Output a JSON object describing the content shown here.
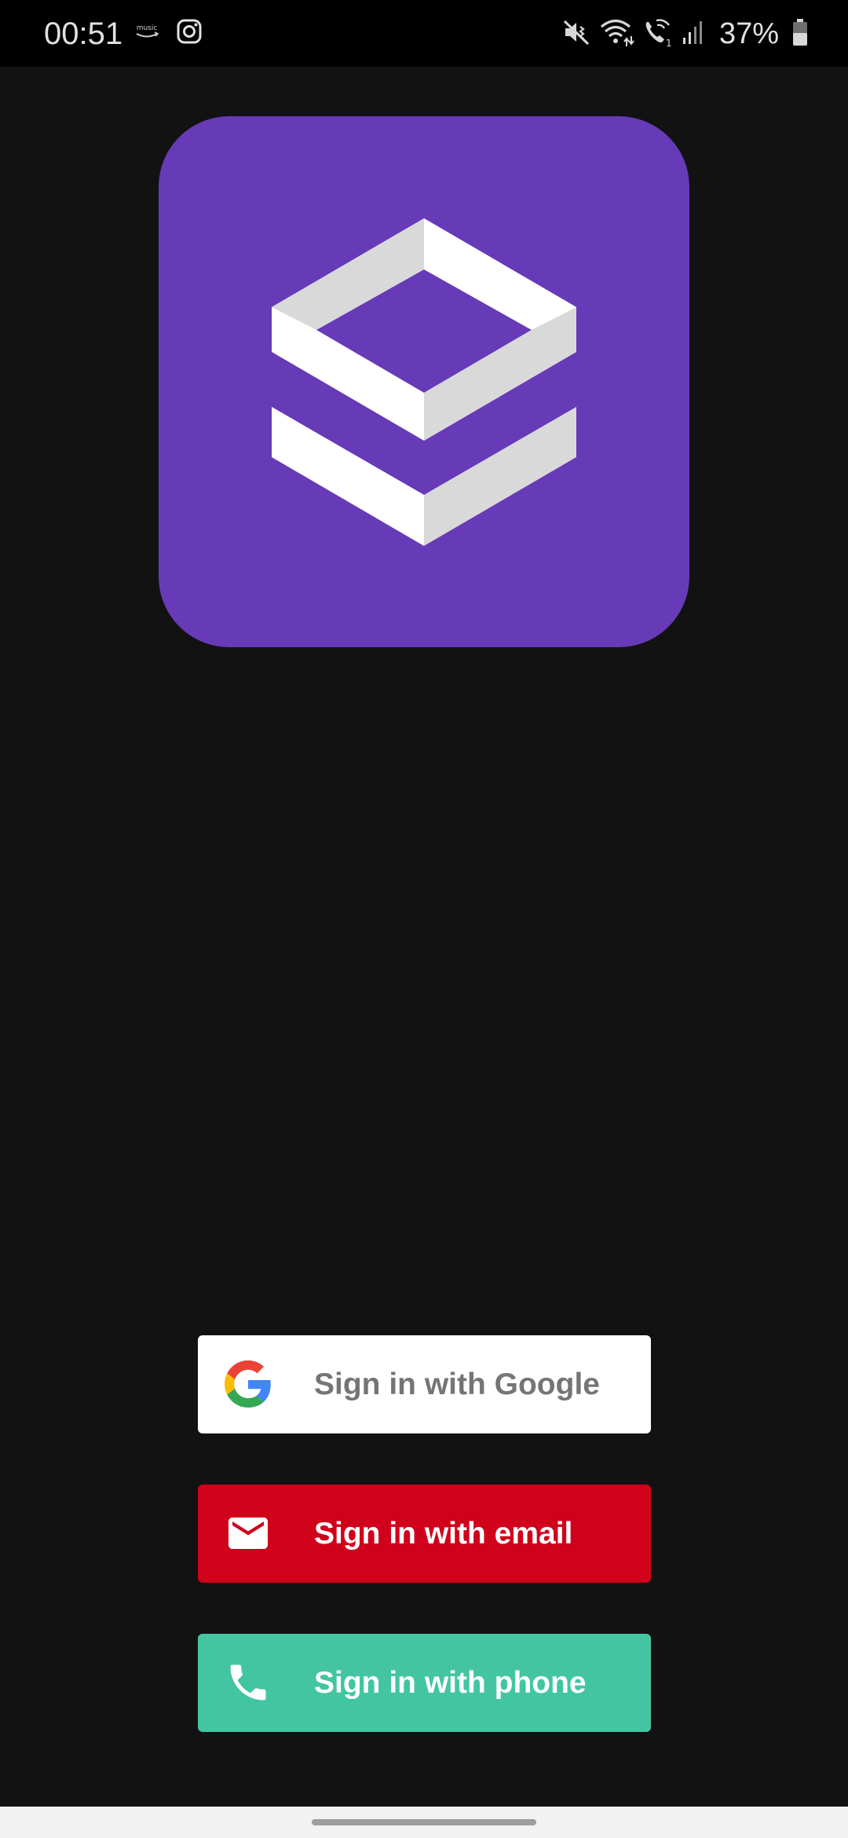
{
  "status_bar": {
    "time": "00:51",
    "left_icons": [
      "amazon-music-icon",
      "instagram-icon"
    ],
    "right_icons": [
      "mute-vibrate-icon",
      "wifi-icon",
      "wifi-calling-icon",
      "signal-icon",
      "battery-icon"
    ],
    "battery_percent": "37%"
  },
  "logo": {
    "icon": "stacked-layers-logo",
    "background_color": "#673ab7"
  },
  "buttons": {
    "google": {
      "label": "Sign in with Google",
      "icon": "google-g-icon",
      "background_color": "#ffffff",
      "text_color": "#757575"
    },
    "email": {
      "label": "Sign in with email",
      "icon": "mail-icon",
      "background_color": "#d0021b",
      "text_color": "#ffffff"
    },
    "phone": {
      "label": "Sign in with phone",
      "icon": "phone-icon",
      "background_color": "#43c5a2",
      "text_color": "#ffffff"
    }
  }
}
